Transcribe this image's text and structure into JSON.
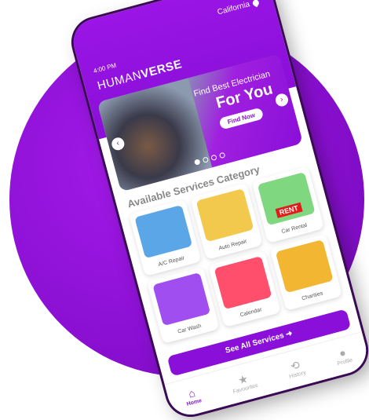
{
  "status": {
    "time": "4:00 PM",
    "location": "California"
  },
  "brand": {
    "part1": "HUMAN",
    "part2": "VERSE"
  },
  "banner": {
    "line1": "Find Best Electrician",
    "line2": "For You",
    "button": "Find Now"
  },
  "section_title": "Available Services Category",
  "services": [
    {
      "label": "A/C Repair",
      "bg": "#5aa6e6",
      "icon": "ac-unit-icon"
    },
    {
      "label": "Auto Repair",
      "bg": "#f2c94c",
      "icon": "car-wrench-icon"
    },
    {
      "label": "Car Rental",
      "bg": "#7fd77f",
      "icon": "rent-car-icon",
      "tag": "RENT"
    },
    {
      "label": "Car Wash",
      "bg": "#a04ef0",
      "icon": "car-wash-icon"
    },
    {
      "label": "Calendar",
      "bg": "#ff4f6d",
      "icon": "calendar-icon"
    },
    {
      "label": "Charities",
      "bg": "#f2b632",
      "icon": "charity-box-icon"
    }
  ],
  "see_all": "See All Services",
  "tabs": [
    {
      "label": "Home",
      "icon": "home-icon",
      "active": true
    },
    {
      "label": "Favourites",
      "icon": "star-icon"
    },
    {
      "label": "History",
      "icon": "history-icon"
    },
    {
      "label": "Profile",
      "icon": "profile-icon"
    }
  ]
}
